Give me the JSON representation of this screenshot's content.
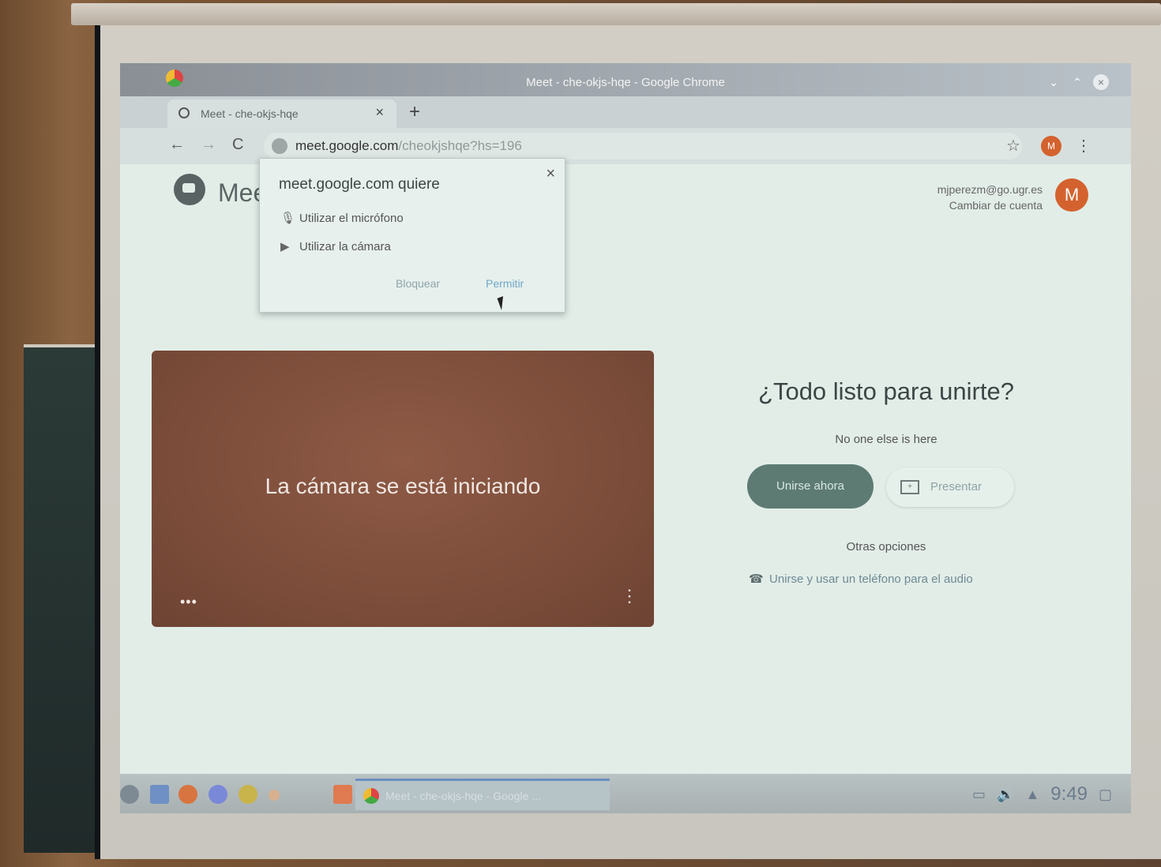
{
  "window": {
    "title": "Meet - che-okjs-hqe - Google Chrome",
    "controls": [
      "minimize",
      "maximize",
      "close"
    ]
  },
  "tabs": [
    {
      "label": "Meet - che-okjs-hqe",
      "close": "×"
    }
  ],
  "new_tab_symbol": "+",
  "toolbar": {
    "back": "←",
    "forward": "→",
    "reload": "C",
    "url_host": "meet.google.com",
    "url_path": "/cheokjshqe?hs=196",
    "star": "☆",
    "avatar_letter": "M",
    "menu": "⋮"
  },
  "page": {
    "app_name": "Mee",
    "account_email": "mjperezm@go.ugr.es",
    "switch_account": "Cambiar de cuenta",
    "avatar_letter": "M"
  },
  "permission_popup": {
    "title": "meet.google.com quiere",
    "close": "×",
    "mic_label": "Utilizar el micrófono",
    "camera_label": "Utilizar la cámara",
    "block_label": "Bloquear",
    "allow_label": "Permitir"
  },
  "preview": {
    "status": "La cámara se está iniciando",
    "dots": "•••",
    "more": "⋮"
  },
  "join": {
    "title": "¿Todo listo para unirte?",
    "subtitle": "No one else is here",
    "join_button": "Unirse ahora",
    "present_button": "Presentar",
    "present_icon_glyph": "+",
    "other_options": "Otras opciones",
    "phone_option": "Unirse y usar un teléfono para el audio"
  },
  "taskbar": {
    "task_label": "Meet - che-okjs-hqe - Google ...",
    "clock": "9:49"
  },
  "colors": {
    "accent_orange": "#d4622e",
    "join_button": "#5d7b73",
    "preview_bg": "#7c4d3a",
    "link_blue": "#6fa6c9"
  }
}
